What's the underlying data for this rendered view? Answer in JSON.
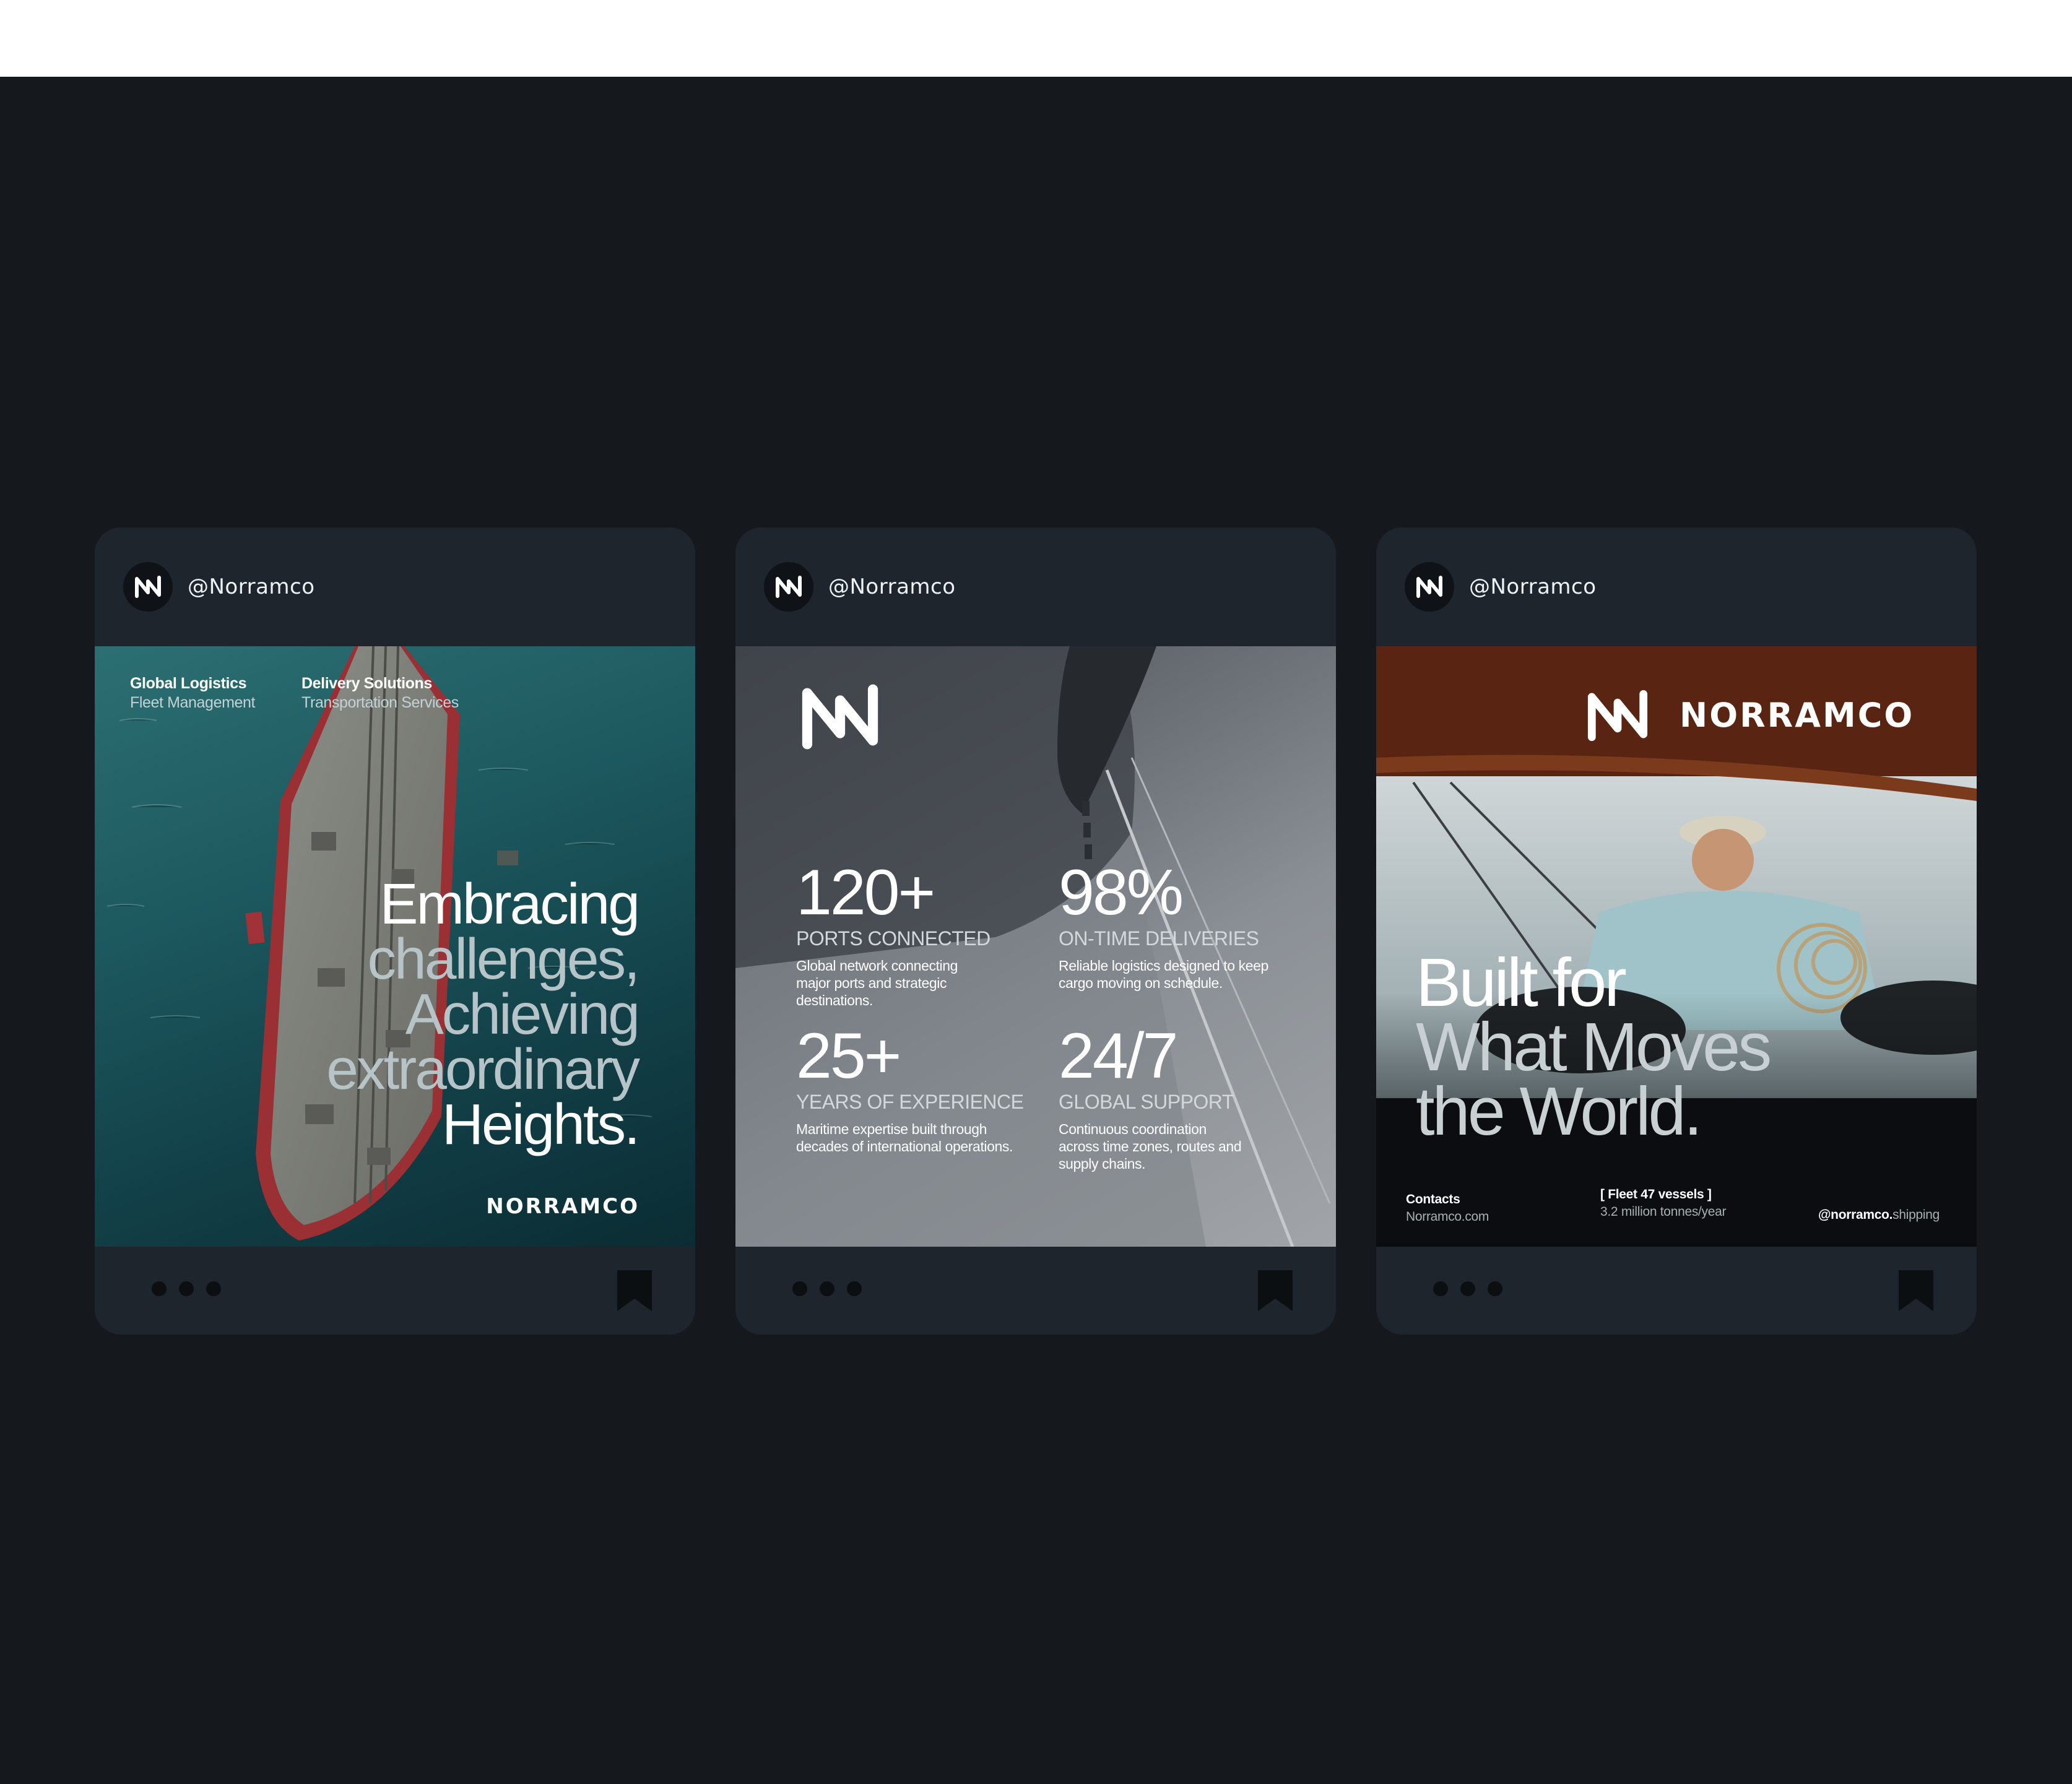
{
  "colors": {
    "page_bg": "#15191d",
    "top_strip": "#ffffff",
    "card_bg": "#1e252c",
    "accent_sea": "#1d5a60",
    "accent_rust": "#6a2a14"
  },
  "cards": [
    {
      "handle": "@Norramco",
      "tags": [
        {
          "title": "Global Logistics",
          "subtitle": "Fleet Management"
        },
        {
          "title": "Delivery Solutions",
          "subtitle": "Transportation Services"
        }
      ],
      "headline": {
        "l1": "Embracing",
        "l2": "challenges,",
        "l3": "Achieving",
        "l4": "extraordinary",
        "l5": "Heights."
      },
      "brand": "NORRAMCO",
      "icons": {
        "avatar": "norramco-logo-icon",
        "menu": "more-dots-icon",
        "save": "bookmark-icon"
      }
    },
    {
      "handle": "@Norramco",
      "stats": [
        {
          "value": "120+",
          "label": "PORTS CONNECTED",
          "desc1": "Global network connecting",
          "desc2": "major ports and strategic",
          "desc3": "destinations."
        },
        {
          "value": "98%",
          "label": "ON-TIME DELIVERIES",
          "desc1": "Reliable logistics designed to keep",
          "desc2": "cargo moving on schedule.",
          "desc3": ""
        },
        {
          "value": "25+",
          "label": "YEARS OF EXPERIENCE",
          "desc1": "Maritime expertise built through",
          "desc2": "decades of international operations.",
          "desc3": ""
        },
        {
          "value": "24/7",
          "label": "GLOBAL SUPPORT",
          "desc1": "Continuous coordination",
          "desc2": "across time zones, routes and",
          "desc3": "supply chains."
        }
      ]
    },
    {
      "handle": "@Norramco",
      "brand": "NORRAMCO",
      "headline": {
        "l1": "Built for",
        "l2": "What Moves",
        "l3": "the World."
      },
      "contacts": {
        "title": "Contacts",
        "value": "Norramco.com"
      },
      "fleet": {
        "title": "[ Fleet 47 vessels ]",
        "value": "3.2 million tonnes/year"
      },
      "social": {
        "bold": "@norramco.",
        "rest": "shipping"
      }
    }
  ]
}
